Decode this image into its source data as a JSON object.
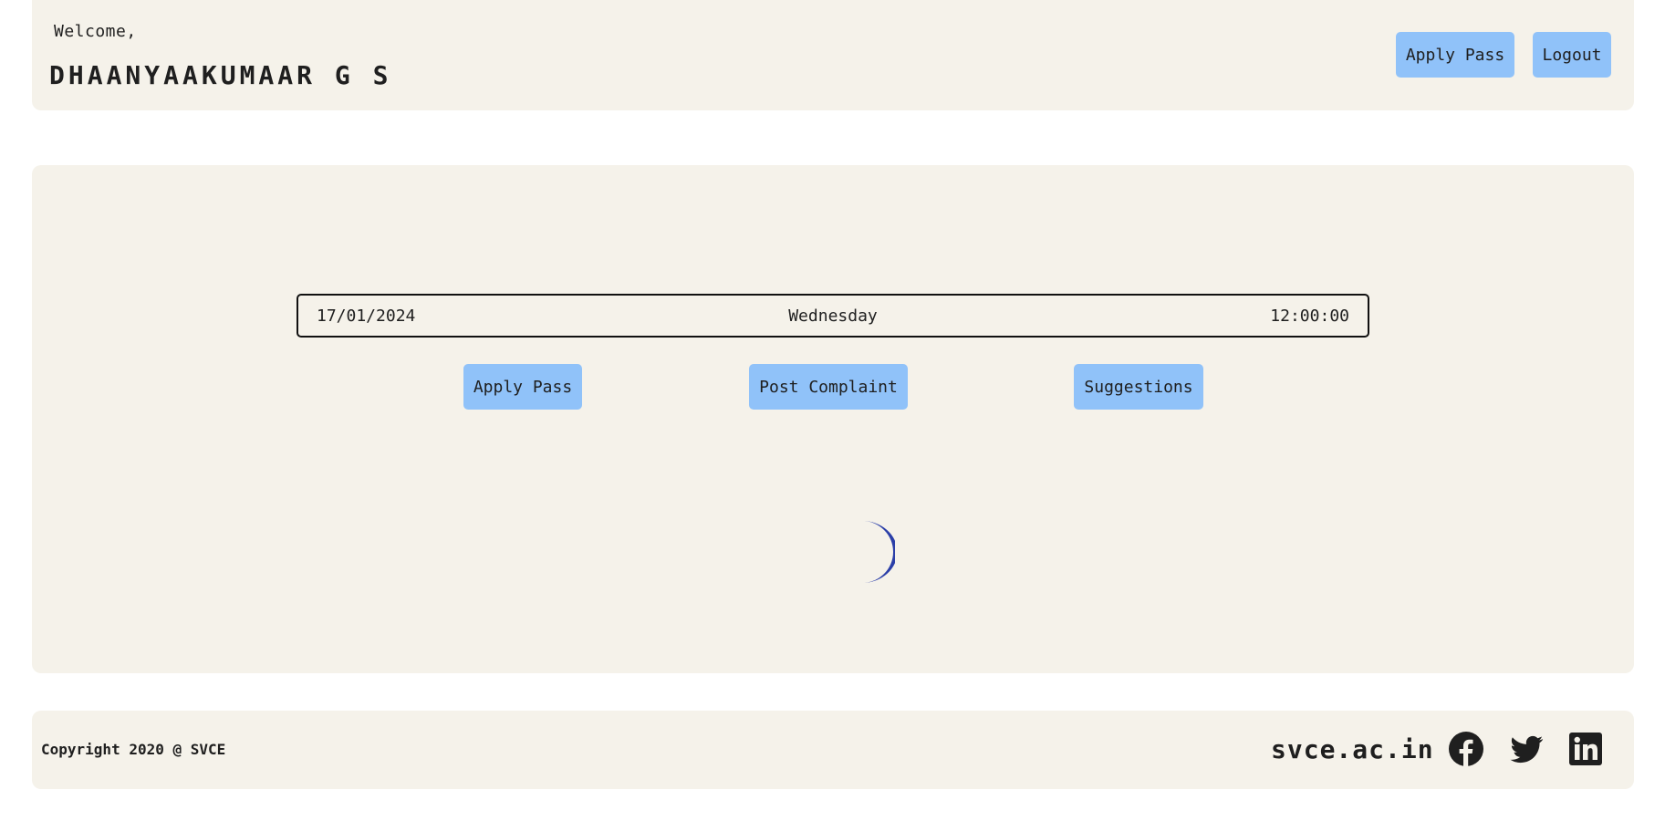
{
  "header": {
    "welcome": "Welcome,",
    "username": "DHAANYAAKUMAAR G S",
    "apply_pass_label": "Apply Pass",
    "logout_label": "Logout"
  },
  "main": {
    "date": "17/01/2024",
    "day": "Wednesday",
    "time": "12:00:00",
    "apply_pass_label": "Apply Pass",
    "post_complaint_label": "Post Complaint",
    "suggestions_label": "Suggestions",
    "spinner_color": "#2b3fa8"
  },
  "footer": {
    "copyright": "Copyright 2020 @ SVCE",
    "site": "svce.ac.in",
    "social_icons": [
      "facebook-icon",
      "twitter-icon",
      "linkedin-icon"
    ]
  },
  "colors": {
    "panel_bg": "#f5f2ea",
    "button_bg": "#90c2f9",
    "text": "#1f1f1f"
  }
}
